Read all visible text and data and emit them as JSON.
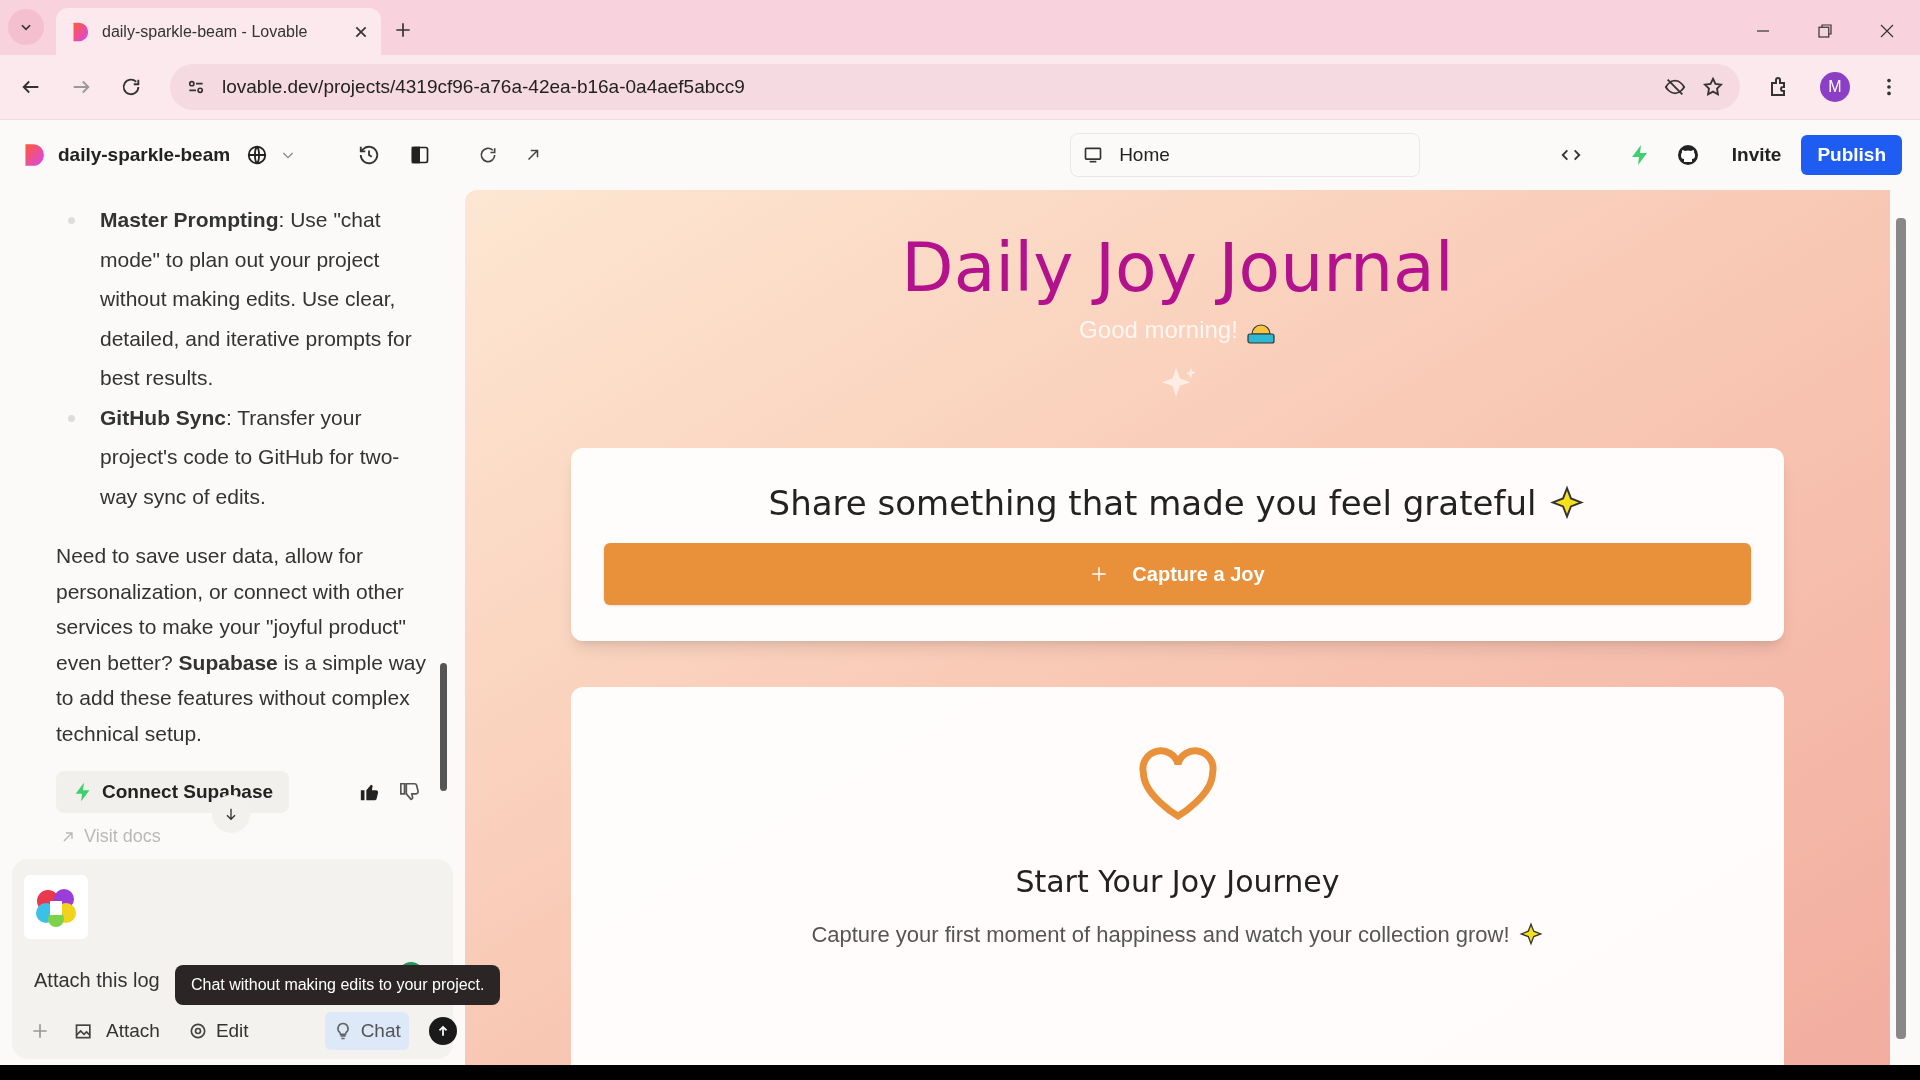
{
  "browser": {
    "tab_title": "daily-sparkle-beam - Lovable",
    "url": "lovable.dev/projects/4319cf96-a76a-42ea-b16a-0a4aef5abcc9",
    "profile_initial": "M"
  },
  "toolbar": {
    "project_name": "daily-sparkle-beam",
    "route": "Home",
    "invite": "Invite",
    "publish": "Publish"
  },
  "chat": {
    "bullets": [
      {
        "text": "**Master Prompting**: Use \"chat mode\" to plan out your project without making edits. Use clear, detailed, and iterative prompts for best results."
      },
      {
        "text": "**GitHub Sync**: Transfer your project's code to GitHub for two-way sync of edits."
      }
    ],
    "paragraph": "Need to save user data, allow for personalization, or connect with other services to make your \"joyful product\" even better? **Supabase** is a simple way to add these features without complex technical setup.",
    "connect_button": "Connect Supabase",
    "visit_docs": "Visit docs",
    "composer": {
      "input_value": "Attach this log",
      "tooltip": "Chat without making edits to your project.",
      "attach": "Attach",
      "modes": [
        {
          "label": "Edit",
          "selected": false
        },
        {
          "label": "Chat",
          "selected": true
        }
      ]
    }
  },
  "preview": {
    "title": "Daily Joy Journal",
    "greeting": "Good morning!",
    "prompt": "Share something that made you feel grateful",
    "capture_button": "Capture a Joy",
    "empty_title": "Start Your Joy Journey",
    "empty_text": "Capture your first moment of happiness and watch your collection grow!"
  }
}
